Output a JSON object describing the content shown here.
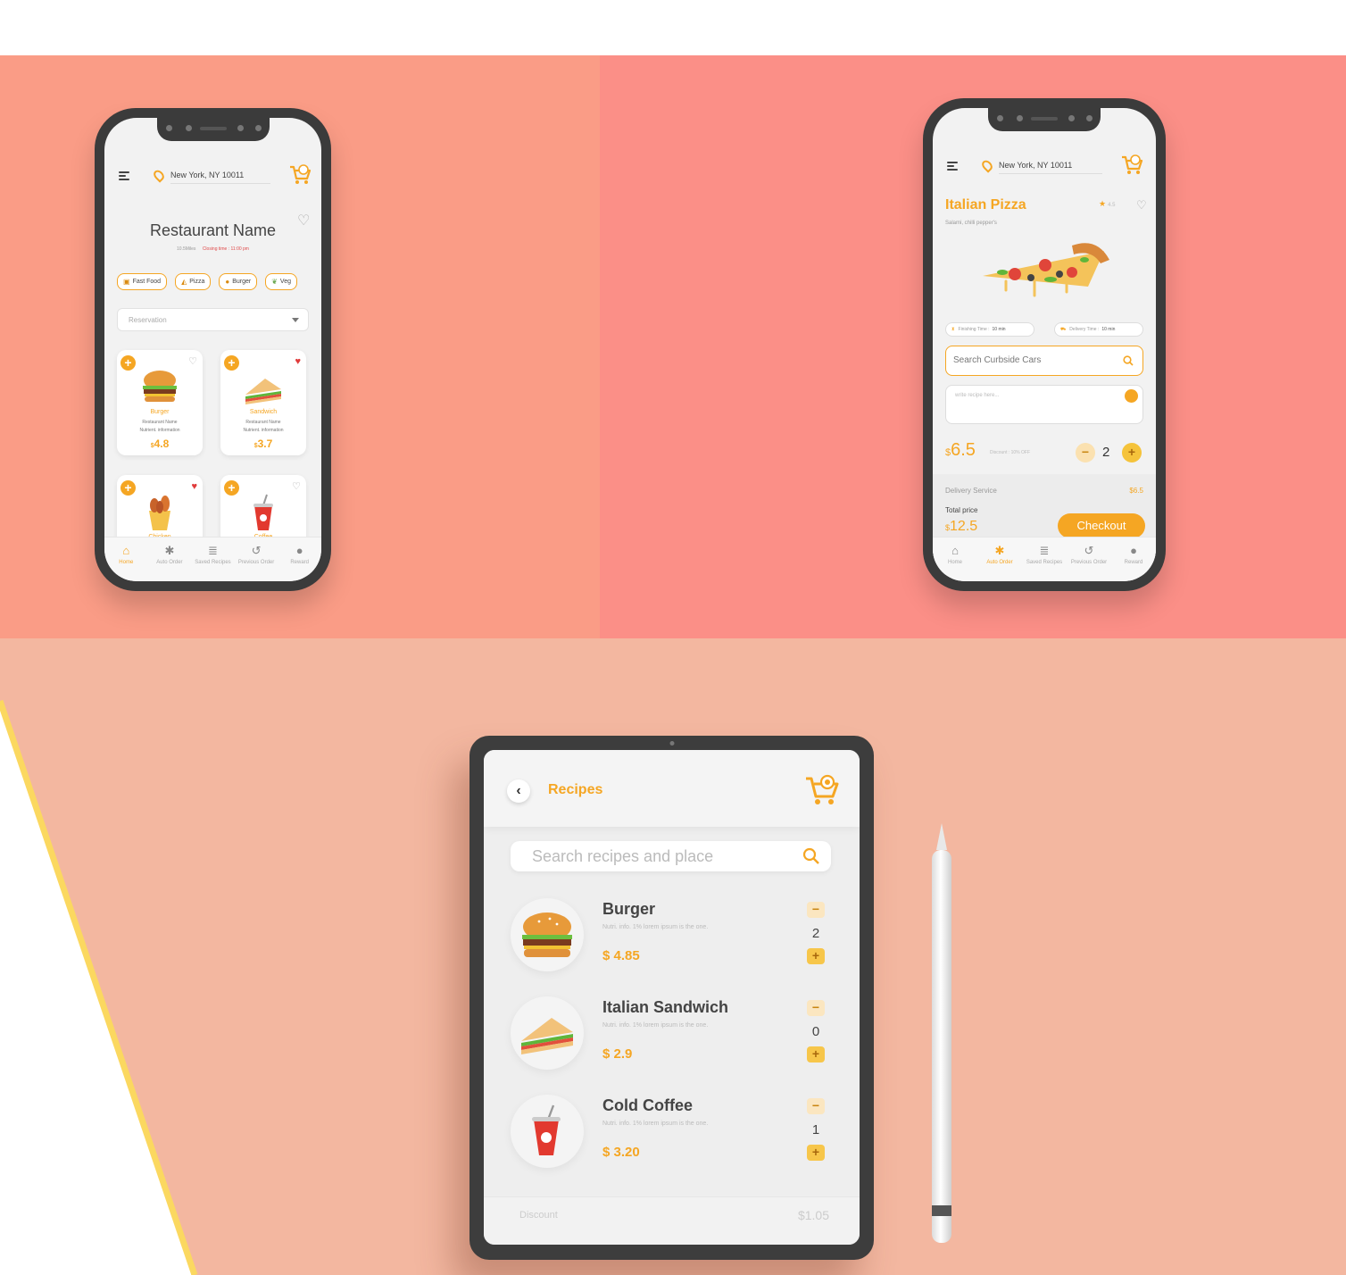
{
  "colors": {
    "accent": "#f5a623",
    "panel_left": "#fa9c86",
    "panel_right": "#fb8f87",
    "panel_bottom": "#f3b7a0",
    "wedge": "#fbd860"
  },
  "phone_home": {
    "location": "New York, NY 10011",
    "restaurant_name": "Restaurant Name",
    "distance": "10.5Miles",
    "closing": "Closing time : 11:00 pm",
    "chips": [
      {
        "label": "Fast Food",
        "icon": "fast-food-icon"
      },
      {
        "label": "Pizza",
        "icon": "pizza-icon"
      },
      {
        "label": "Burger",
        "icon": "burger-icon"
      },
      {
        "label": "Veg",
        "icon": "veg-icon"
      }
    ],
    "dropdown_value": "Reservation",
    "foods": [
      {
        "name": "Burger",
        "restaurant": "Restaurant Name",
        "info": "Nutrient. information",
        "currency": "$",
        "price": "4.8",
        "favorite": false
      },
      {
        "name": "Sandwich",
        "restaurant": "Restaurant Name",
        "info": "Nutrient. information",
        "currency": "$",
        "price": "3.7",
        "favorite": true
      },
      {
        "name": "Chicken",
        "restaurant": "",
        "info": "",
        "currency": "",
        "price": "",
        "favorite": true
      },
      {
        "name": "Coffee",
        "restaurant": "",
        "info": "",
        "currency": "",
        "price": "",
        "favorite": false
      }
    ],
    "nav": [
      "Home",
      "Auto Order",
      "Saved Recipes",
      "Previous Order",
      "Reward"
    ]
  },
  "phone_detail": {
    "location": "New York, NY 10011",
    "dish_name": "Italian Pizza",
    "dish_desc": "Salami, chilli pepper's",
    "rating": "4.5",
    "finishing_label": "Finishing Time :",
    "finishing_value": "10 min",
    "delivery_label": "Delivery Time :",
    "delivery_value": "10 min",
    "search_placeholder": "Search Curbside Cars",
    "note_placeholder": "write recipe here...",
    "currency": "$",
    "price": "6.5",
    "discount": "Discount : 10% OFF",
    "quantity": "2",
    "delivery_service_label": "Delivery Service",
    "delivery_service_value": "$6.5",
    "total_label": "Total price",
    "total_currency": "$",
    "total_value": "12.5",
    "checkout_label": "Checkout",
    "nav": [
      "Home",
      "Auto Order",
      "Saved Recipes",
      "Previous Order",
      "Reward"
    ]
  },
  "tablet": {
    "title": "Recipes",
    "search_placeholder": "Search recipes and place",
    "recipes": [
      {
        "name": "Burger",
        "desc": "Nutri. info. 1% lorem ipsum is the one.",
        "price": "$ 4.85",
        "qty": "2"
      },
      {
        "name": "Italian Sandwich",
        "desc": "Nutri. info. 1% lorem ipsum is the one.",
        "price": "$ 2.9",
        "qty": "0"
      },
      {
        "name": "Cold Coffee",
        "desc": "Nutri. info. 1% lorem ipsum is the one.",
        "price": "$ 3.20",
        "qty": "1"
      }
    ],
    "discount_label": "Discount",
    "discount_value": "$1.05"
  }
}
